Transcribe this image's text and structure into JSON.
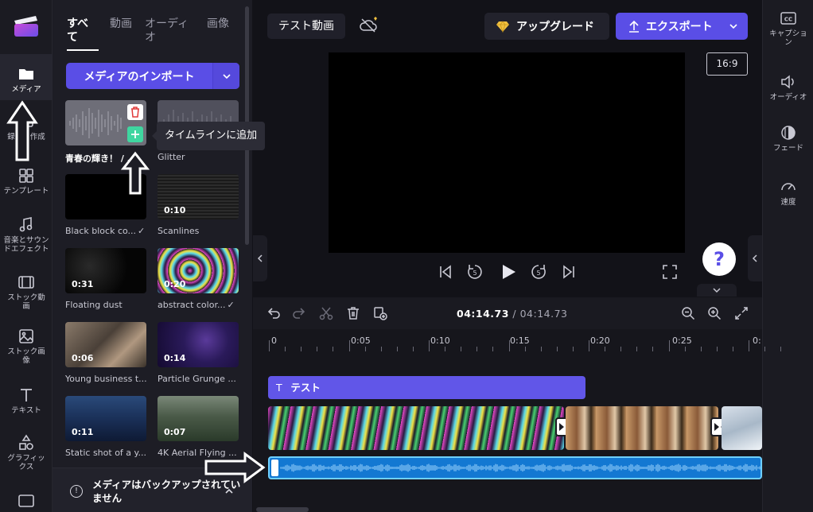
{
  "rail": {
    "items": [
      {
        "label": "メディア",
        "icon": "folder-icon"
      },
      {
        "label": "録画と作成",
        "icon": "record-icon"
      },
      {
        "label": "テンプレート",
        "icon": "templates-icon"
      },
      {
        "label": "音楽とサウンドエフェクト",
        "icon": "music-note-icon"
      },
      {
        "label": "ストック動画",
        "icon": "film-icon"
      },
      {
        "label": "ストック画像",
        "icon": "image-icon"
      },
      {
        "label": "テキスト",
        "icon": "text-t-icon"
      },
      {
        "label": "グラフィックス",
        "icon": "shapes-icon"
      }
    ]
  },
  "media": {
    "tabs": [
      {
        "label": "すべて"
      },
      {
        "label": "動画"
      },
      {
        "label": "オーディオ"
      },
      {
        "label": "画像"
      }
    ],
    "import_label": "メディアのインポート",
    "tooltip": "タイムラインに追加",
    "cards": [
      {
        "title": "青春の輝き！ / ...",
        "duration": "",
        "checked": false
      },
      {
        "title": "Glitter",
        "duration": "",
        "checked": false
      },
      {
        "title": "Black block co...",
        "duration": "",
        "checked": true
      },
      {
        "title": "Scanlines",
        "duration": "0:10",
        "checked": false
      },
      {
        "title": "Floating dust",
        "duration": "0:31",
        "checked": false
      },
      {
        "title": "abstract color...",
        "duration": "0:20",
        "checked": true
      },
      {
        "title": "Young business t...",
        "duration": "0:06",
        "checked": false
      },
      {
        "title": "Particle Grunge ...",
        "duration": "0:14",
        "checked": false
      },
      {
        "title": "Static shot of a y...",
        "duration": "0:11",
        "checked": false
      },
      {
        "title": "4K Aerial Flying ...",
        "duration": "0:07",
        "checked": false
      }
    ],
    "backup_text": "メディアはバックアップされていません"
  },
  "topbar": {
    "project_title": "テスト動画",
    "upgrade_label": "アップグレード",
    "export_label": "エクスポート"
  },
  "preview": {
    "aspect_ratio": "16:9",
    "help": "?",
    "seek_seconds": "5"
  },
  "right_panel": {
    "items": [
      {
        "label": "キャプション",
        "icon": "captions-icon"
      },
      {
        "label": "オーディオ",
        "icon": "speaker-icon"
      },
      {
        "label": "フェード",
        "icon": "fade-icon"
      },
      {
        "label": "速度",
        "icon": "speed-gauge-icon"
      }
    ]
  },
  "timeline": {
    "current_time": "04:14.73",
    "separator": " / ",
    "total_time": "04:14.73",
    "ruler": [
      "0",
      "0:05",
      "0:10",
      "0:15",
      "0:20",
      "0:25",
      "0:"
    ],
    "text_clip": "テスト"
  },
  "colors": {
    "accent": "#5a4ee6",
    "audio_track": "#1378d2",
    "text_track": "#6156e8",
    "background": "#121218"
  }
}
